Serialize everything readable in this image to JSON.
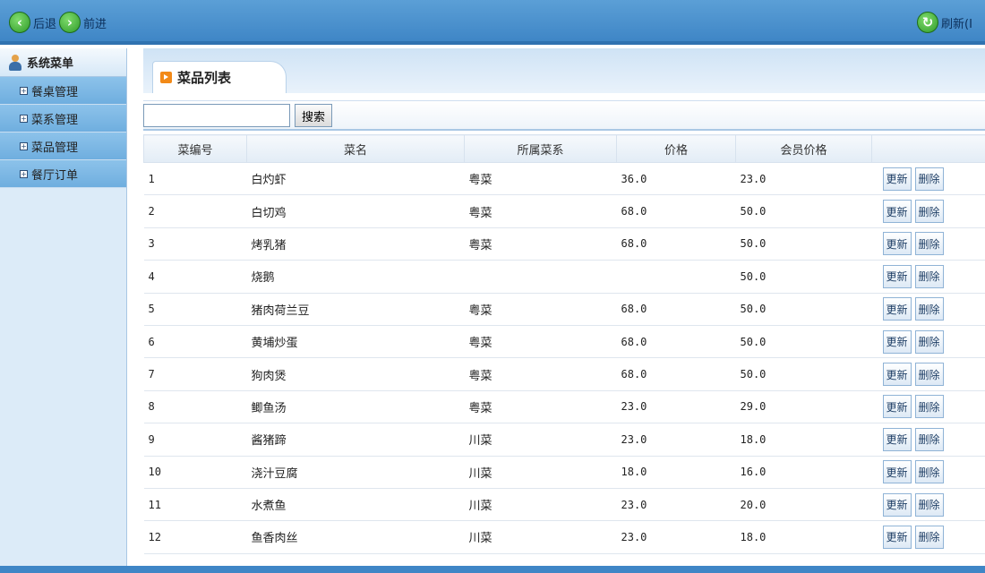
{
  "topbar": {
    "back_label": "后退",
    "forward_label": "前进",
    "refresh_label": "刷新(I"
  },
  "sidebar": {
    "title": "系统菜单",
    "items": [
      {
        "label": "餐桌管理"
      },
      {
        "label": "菜系管理"
      },
      {
        "label": "菜品管理"
      },
      {
        "label": "餐厅订单"
      }
    ]
  },
  "main": {
    "tab_title": "菜品列表",
    "search": {
      "value": "",
      "placeholder": "",
      "button_label": "搜索"
    },
    "columns": [
      "菜编号",
      "菜名",
      "所属菜系",
      "价格",
      "会员价格",
      ""
    ],
    "update_label": "更新",
    "delete_label": "删除",
    "rows": [
      {
        "id": "1",
        "name": "白灼虾",
        "cuisine": "粤菜",
        "price": "36.0",
        "member_price": "23.0"
      },
      {
        "id": "2",
        "name": "白切鸡",
        "cuisine": "粤菜",
        "price": "68.0",
        "member_price": "50.0"
      },
      {
        "id": "3",
        "name": "烤乳猪",
        "cuisine": "粤菜",
        "price": "68.0",
        "member_price": "50.0"
      },
      {
        "id": "4",
        "name": "烧鹅",
        "cuisine": "",
        "price": "",
        "member_price": "50.0"
      },
      {
        "id": "5",
        "name": "猪肉荷兰豆",
        "cuisine": "粤菜",
        "price": "68.0",
        "member_price": "50.0"
      },
      {
        "id": "6",
        "name": "黄埔炒蛋",
        "cuisine": "粤菜",
        "price": "68.0",
        "member_price": "50.0"
      },
      {
        "id": "7",
        "name": "狗肉煲",
        "cuisine": "粤菜",
        "price": "68.0",
        "member_price": "50.0"
      },
      {
        "id": "8",
        "name": "鲫鱼汤",
        "cuisine": "粤菜",
        "price": "23.0",
        "member_price": "29.0"
      },
      {
        "id": "9",
        "name": "酱猪蹄",
        "cuisine": "川菜",
        "price": "23.0",
        "member_price": "18.0"
      },
      {
        "id": "10",
        "name": "浇汁豆腐",
        "cuisine": "川菜",
        "price": "18.0",
        "member_price": "16.0"
      },
      {
        "id": "11",
        "name": "水煮鱼",
        "cuisine": "川菜",
        "price": "23.0",
        "member_price": "20.0"
      },
      {
        "id": "12",
        "name": "鱼香肉丝",
        "cuisine": "川菜",
        "price": "23.0",
        "member_price": "18.0"
      }
    ]
  }
}
